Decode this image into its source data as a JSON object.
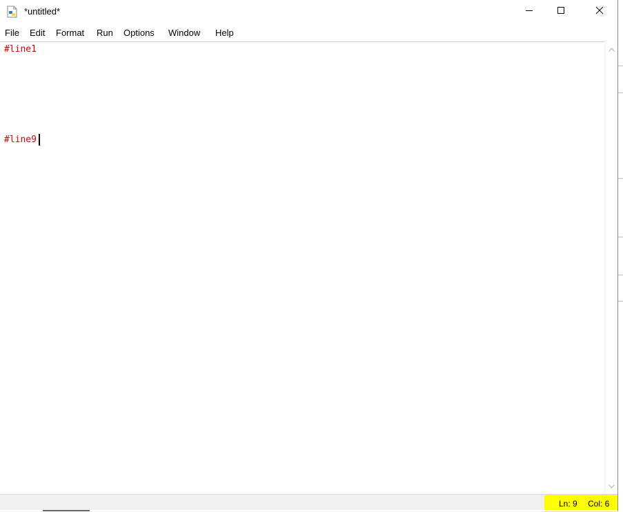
{
  "window": {
    "title": "*untitled*",
    "icon": "python-file-icon",
    "controls": [
      "minimize-icon",
      "maximize-icon",
      "close-icon"
    ]
  },
  "menu": {
    "items": [
      "File",
      "Edit",
      "Format",
      "Run",
      "Options",
      "Window",
      "Help"
    ]
  },
  "editor": {
    "lines": [
      {
        "number": 1,
        "text": "#line1"
      },
      {
        "number": 9,
        "text": "#line9"
      }
    ],
    "comment_color": "#dd0000",
    "cursor_line": 9
  },
  "status": {
    "ln": "Ln: 9",
    "col": "Col: 6",
    "highlight_color": "#ffff00"
  }
}
